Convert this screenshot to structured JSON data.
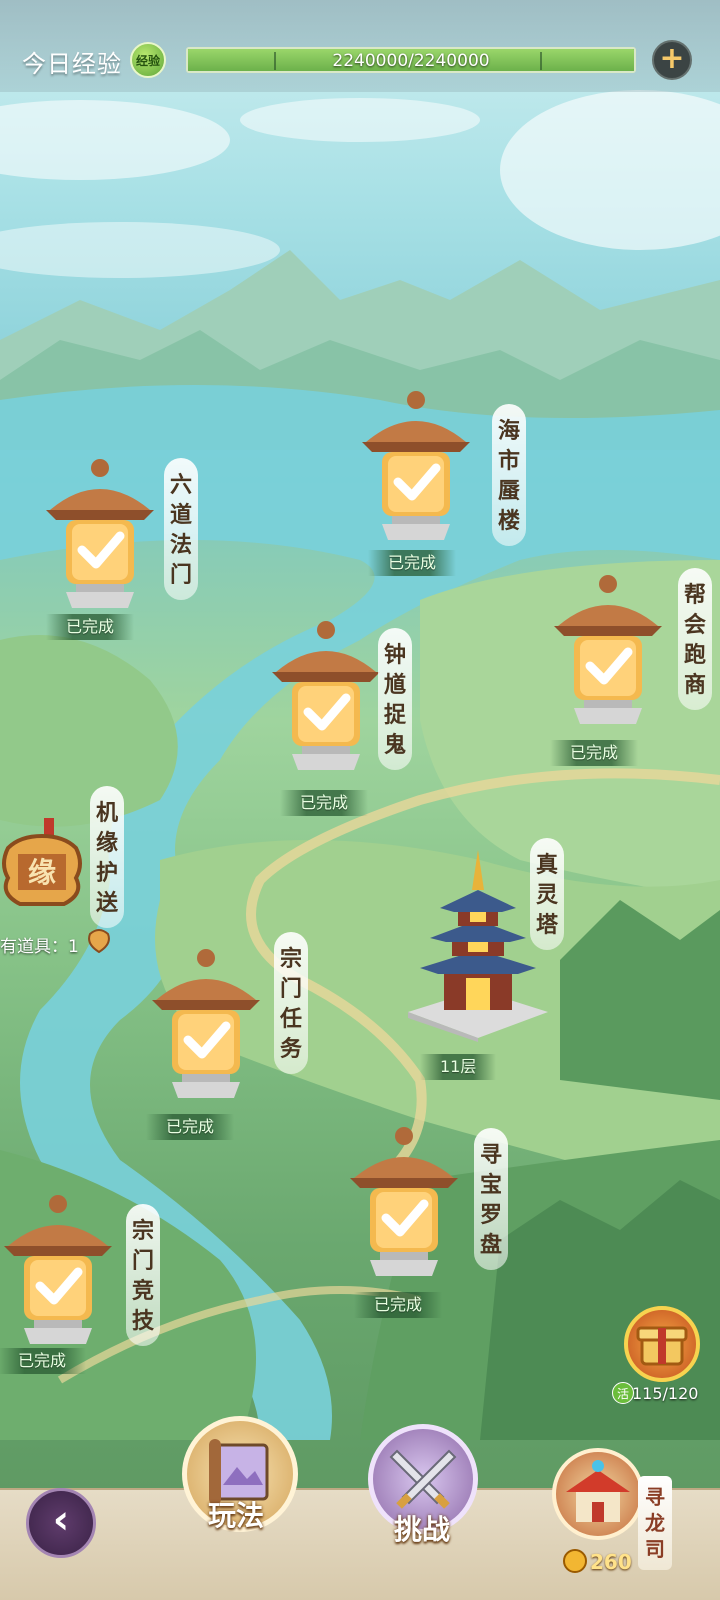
{
  "header": {
    "exp_label": "今日经验",
    "exp_badge": "经验",
    "exp_value": "2240000/2240000",
    "exp_progress": 1.0
  },
  "quests": [
    {
      "title": "六道法门",
      "status": "已完成"
    },
    {
      "title": "海市蜃楼",
      "status": "已完成"
    },
    {
      "title": "帮会跑商",
      "status": "已完成"
    },
    {
      "title": "钟馗捉鬼",
      "status": "已完成"
    },
    {
      "title": "宗门任务",
      "status": "已完成"
    },
    {
      "title": "寻宝罗盘",
      "status": "已完成"
    },
    {
      "title": "宗门竞技",
      "status": "已完成"
    }
  ],
  "escort": {
    "title": "机缘护送",
    "icon_char": "缘",
    "items_label": "有道具：1"
  },
  "tower": {
    "title": "真灵塔",
    "floor": "11层"
  },
  "activity": {
    "badge": "活",
    "progress": "115/120"
  },
  "bottom": {
    "play_label": "玩法",
    "challenge_label": "挑战",
    "dragon_label": "寻龙司",
    "coins": "260"
  },
  "colors": {
    "accent_gold": "#f6c96a",
    "status_green": "#2f6b3a",
    "exp_green": "#6cb14b"
  }
}
